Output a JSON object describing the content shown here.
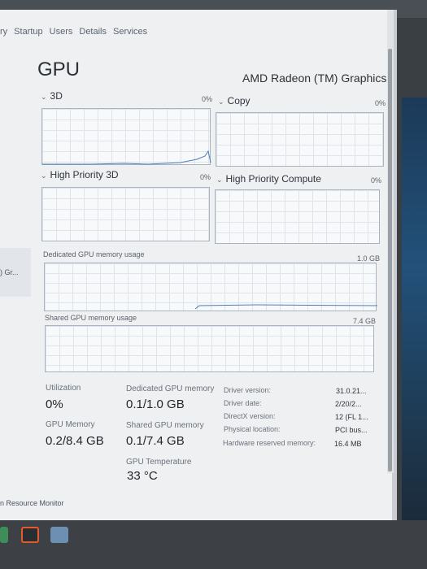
{
  "tabs": [
    "ry",
    "Startup",
    "Users",
    "Details",
    "Services"
  ],
  "side_item": ") Gr...",
  "gpu": {
    "title": "GPU",
    "name": "AMD Radeon (TM) Graphics"
  },
  "graphs": {
    "g3d": {
      "label": "3D",
      "pct": "0%"
    },
    "copy": {
      "label": "Copy",
      "pct": "0%"
    },
    "hp3d": {
      "label": "High Priority 3D",
      "pct": "0%"
    },
    "hpc": {
      "label": "High Priority Compute",
      "pct": "0%"
    }
  },
  "memory_graphs": {
    "dedicated": {
      "label": "Dedicated GPU memory usage",
      "max": "1.0 GB"
    },
    "shared": {
      "label": "Shared GPU memory usage",
      "max": "7.4 GB"
    }
  },
  "stats": {
    "utilization": {
      "label": "Utilization",
      "value": "0%"
    },
    "dedicated": {
      "label": "Dedicated GPU memory",
      "value": "0.1/1.0 GB"
    },
    "gpu_memory": {
      "label": "GPU Memory",
      "value": "0.2/8.4 GB"
    },
    "shared": {
      "label": "Shared GPU memory",
      "value": "0.1/7.4 GB"
    },
    "temperature": {
      "label": "GPU Temperature",
      "value": "33 °C"
    }
  },
  "details": [
    {
      "key": "Driver version:",
      "value": "31.0.21..."
    },
    {
      "key": "Driver date:",
      "value": "2/20/2..."
    },
    {
      "key": "DirectX version:",
      "value": "12 (FL 1..."
    },
    {
      "key": "Physical location:",
      "value": "PCI bus..."
    },
    {
      "key": "Hardware reserved memory:",
      "value": "16.4 MB"
    }
  ],
  "bottom_link": "n Resource Monitor",
  "icons": {
    "chevron": "chevron-down-icon"
  }
}
